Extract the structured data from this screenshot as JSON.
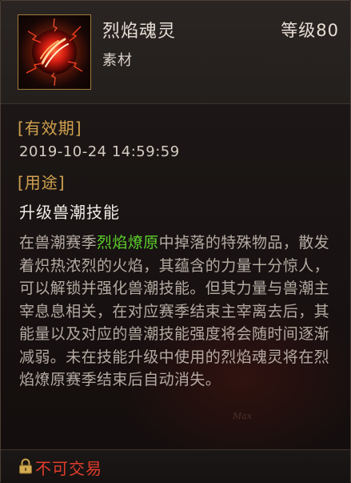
{
  "item": {
    "name": "烈焰魂灵",
    "level": "等级80",
    "type": "素材",
    "icon": "fire-orb-icon"
  },
  "expiry": {
    "heading": "[有效期]",
    "value": "2019-10-24 14:59:59"
  },
  "usage": {
    "heading": "[用途]",
    "value": "升级兽潮技能"
  },
  "description": {
    "before": "在兽潮赛季",
    "highlight": "烈焰燎原",
    "after": "中掉落的特殊物品，散发着炽热浓烈的火焰，其蕴含的力量十分惊人，可以解锁并强化兽潮技能。但其力量与兽潮主宰息息相关，在对应赛季结束主宰离去后，其能量以及对应的兽潮技能强度将会随时间逐渐减弱。未在技能升级中使用的烈焰魂灵将在烈焰燎原赛季结束后自动消失。"
  },
  "watermark": "Max",
  "footer": {
    "trade_status": "不可交易",
    "lock_icon": "lock-icon"
  },
  "colors": {
    "heading_gold": "#d1a14f",
    "highlight_green": "#5ccf2b",
    "untradeable_red": "#e13c2c",
    "icon_border": "#a37a3a"
  }
}
